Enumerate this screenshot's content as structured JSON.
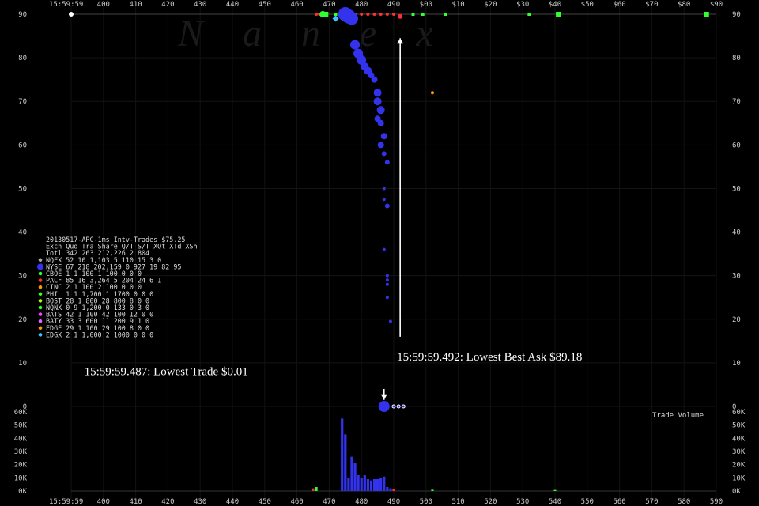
{
  "watermark": "Nanex",
  "chart_data": {
    "type": "scatter",
    "x_ticks": [
      "15:59:59",
      "400",
      "410",
      "420",
      "430",
      "440",
      "450",
      "460",
      "470",
      "480",
      "490",
      "500",
      "510",
      "520",
      "530",
      "540",
      "550",
      "560",
      "570",
      "580",
      "590"
    ],
    "x_top_ticks": [
      "15:59:59",
      "400",
      "410",
      "420",
      "430",
      "440",
      "450",
      "460",
      "470",
      "480",
      "490",
      "$00",
      "$10",
      "$20",
      "$30",
      "$40",
      "$50",
      "$60",
      "$70",
      "$80",
      "$90"
    ],
    "y_ticks": [
      "0",
      "10",
      "20",
      "30",
      "40",
      "50",
      "60",
      "70",
      "80",
      "90"
    ],
    "y_range": [
      0,
      90
    ],
    "volume_ticks": [
      "0K",
      "10K",
      "20K",
      "30K",
      "40K",
      "50K",
      "60K"
    ],
    "volume_range": [
      0,
      60000
    ],
    "volume_label": "Trade Volume",
    "x_range": [
      390,
      590
    ],
    "trades_nyse": [
      {
        "x": 475,
        "y": 90,
        "s": 9
      },
      {
        "x": 476,
        "y": 89.5,
        "s": 9
      },
      {
        "x": 477,
        "y": 89,
        "s": 8
      },
      {
        "x": 478,
        "y": 83,
        "s": 6
      },
      {
        "x": 479,
        "y": 81,
        "s": 6
      },
      {
        "x": 480,
        "y": 79.5,
        "s": 6
      },
      {
        "x": 481,
        "y": 78,
        "s": 5
      },
      {
        "x": 482,
        "y": 77,
        "s": 5
      },
      {
        "x": 483,
        "y": 76,
        "s": 4
      },
      {
        "x": 484,
        "y": 75,
        "s": 4
      },
      {
        "x": 485,
        "y": 72,
        "s": 5
      },
      {
        "x": 485,
        "y": 70,
        "s": 5
      },
      {
        "x": 486,
        "y": 68,
        "s": 5
      },
      {
        "x": 485,
        "y": 66,
        "s": 4
      },
      {
        "x": 486,
        "y": 65,
        "s": 4
      },
      {
        "x": 487,
        "y": 62,
        "s": 4
      },
      {
        "x": 486,
        "y": 60,
        "s": 4
      },
      {
        "x": 487,
        "y": 58,
        "s": 3
      },
      {
        "x": 488,
        "y": 56,
        "s": 3
      },
      {
        "x": 487,
        "y": 50,
        "s": 2
      },
      {
        "x": 487,
        "y": 47.5,
        "s": 2
      },
      {
        "x": 488,
        "y": 46,
        "s": 3
      },
      {
        "x": 487,
        "y": 36,
        "s": 2
      },
      {
        "x": 488,
        "y": 30,
        "s": 2
      },
      {
        "x": 488,
        "y": 29,
        "s": 2
      },
      {
        "x": 488,
        "y": 28,
        "s": 2
      },
      {
        "x": 488,
        "y": 25,
        "s": 2
      },
      {
        "x": 489,
        "y": 19.5,
        "s": 2
      },
      {
        "x": 487,
        "y": 0,
        "s": 7
      }
    ],
    "trades_edge": [
      {
        "x": 502,
        "y": 72,
        "s": 2
      }
    ],
    "trades_low_tail": [
      {
        "x": 490,
        "y": 0,
        "s": 2
      },
      {
        "x": 491.5,
        "y": 0,
        "s": 2
      },
      {
        "x": 493,
        "y": 0,
        "s": 2
      }
    ],
    "quotes_top": [
      {
        "x": 390,
        "y": 90,
        "c": "#ffffff",
        "s": 3
      },
      {
        "x": 466,
        "y": 90,
        "c": "#ff3030",
        "s": 2
      },
      {
        "x": 467,
        "y": 90,
        "c": "#ff3030",
        "s": 2
      },
      {
        "x": 468,
        "y": 90,
        "c": "#30ff30",
        "s": 4
      },
      {
        "x": 469,
        "y": 90,
        "c": "#30ff30",
        "s": 3
      },
      {
        "x": 472,
        "y": 89,
        "c": "#40c0ff",
        "s": 4
      },
      {
        "x": 472,
        "y": 90,
        "c": "#30ff30",
        "s": 2
      },
      {
        "x": 478,
        "y": 90,
        "c": "#ff3030",
        "s": 2
      },
      {
        "x": 480,
        "y": 90,
        "c": "#ff3030",
        "s": 2
      },
      {
        "x": 482,
        "y": 90,
        "c": "#ff3030",
        "s": 2
      },
      {
        "x": 484,
        "y": 90,
        "c": "#ff3030",
        "s": 2
      },
      {
        "x": 486,
        "y": 90,
        "c": "#ff3030",
        "s": 2
      },
      {
        "x": 488,
        "y": 90,
        "c": "#ff3030",
        "s": 2
      },
      {
        "x": 490,
        "y": 90,
        "c": "#ff3030",
        "s": 2
      },
      {
        "x": 492,
        "y": 89.5,
        "c": "#ff3030",
        "s": 3
      },
      {
        "x": 496,
        "y": 90,
        "c": "#30ff30",
        "s": 2
      },
      {
        "x": 499,
        "y": 90,
        "c": "#30ff30",
        "s": 2
      },
      {
        "x": 506,
        "y": 90,
        "c": "#30ff30",
        "s": 2
      },
      {
        "x": 532,
        "y": 90,
        "c": "#30ff30",
        "s": 2
      },
      {
        "x": 541,
        "y": 90,
        "c": "#30ff30",
        "s": 3
      },
      {
        "x": 587,
        "y": 90,
        "c": "#30ff30",
        "s": 3
      }
    ],
    "volume_bars": [
      {
        "x": 465,
        "v": 2000,
        "c": "#ff3030"
      },
      {
        "x": 466,
        "v": 3000,
        "c": "#30ff30"
      },
      {
        "x": 474,
        "v": 55000,
        "c": "#3333ee"
      },
      {
        "x": 475,
        "v": 43000,
        "c": "#3333ee"
      },
      {
        "x": 476,
        "v": 10000,
        "c": "#3333ee"
      },
      {
        "x": 477,
        "v": 26000,
        "c": "#3333ee"
      },
      {
        "x": 478,
        "v": 21000,
        "c": "#3333ee"
      },
      {
        "x": 479,
        "v": 12000,
        "c": "#3333ee"
      },
      {
        "x": 480,
        "v": 10000,
        "c": "#3333ee"
      },
      {
        "x": 481,
        "v": 12000,
        "c": "#3333ee"
      },
      {
        "x": 482,
        "v": 9000,
        "c": "#3333ee"
      },
      {
        "x": 483,
        "v": 8000,
        "c": "#3333ee"
      },
      {
        "x": 484,
        "v": 9000,
        "c": "#3333ee"
      },
      {
        "x": 485,
        "v": 9000,
        "c": "#3333ee"
      },
      {
        "x": 486,
        "v": 10000,
        "c": "#3333ee"
      },
      {
        "x": 487,
        "v": 11000,
        "c": "#3333ee"
      },
      {
        "x": 488,
        "v": 3000,
        "c": "#3333ee"
      },
      {
        "x": 489,
        "v": 2000,
        "c": "#3333ee"
      },
      {
        "x": 490,
        "v": 1500,
        "c": "#ff3030"
      },
      {
        "x": 502,
        "v": 1000,
        "c": "#30ff30"
      },
      {
        "x": 540,
        "v": 800,
        "c": "#30ff30"
      }
    ],
    "annotations": [
      {
        "text": "15:59:59.487: Lowest Trade $0.01",
        "x": 448,
        "y": 7.2,
        "arrow_x": 487,
        "arrow_from": 4,
        "arrow_to": 1.5
      },
      {
        "text": "15:59:59.492: Lowest Best Ask $89.18",
        "x": 492,
        "y": 10.5,
        "arrow_x": 492,
        "arrow_from": 16,
        "arrow_to": 84.5
      }
    ],
    "legend": {
      "title": "20130517-APC-1ms Intv-Trades $75.25",
      "header": "Exch Quo  Tra   Share  Q/T  S/T  XQt XTd XSh",
      "rows": [
        {
          "dot": "",
          "text": "Totl 342 263 212,226   2   804"
        },
        {
          "dot": "#aaaaaa",
          "text": "NQEX  52  10   1,103   5   110  15   3   0"
        },
        {
          "dot": "#3333ee",
          "text": "NYSE  67 218 202,159   0   927  19  82  95"
        },
        {
          "dot": "#30ff30",
          "text": "CBOE   1   1     100   1   100   0   0   0"
        },
        {
          "dot": "#ff3030",
          "text": "PACF  85  16   3,264   5   204  24   6   1"
        },
        {
          "dot": "#ff9900",
          "text": "CINC   2   1     100   2   100   0   0   0"
        },
        {
          "dot": "#30ff30",
          "text": "PHIL   1   1   1,700   1  1700   0   0   0"
        },
        {
          "dot": "#aaff00",
          "text": "BOST  28   1     800  28   800   8   0   0"
        },
        {
          "dot": "#30ff30",
          "text": "NQNX   0   9   1,200   0   133   0   3   0"
        },
        {
          "dot": "#ff44ff",
          "text": "BATS  42   1     100  42   100  12   0   0"
        },
        {
          "dot": "#dd66ff",
          "text": "BATY  33   3     600  11   200   9   1   0"
        },
        {
          "dot": "#ff9900",
          "text": "EDGE  29   1     100  29   100   8   0   0"
        },
        {
          "dot": "#40c0ff",
          "text": "EDGX   2   1   1,000   2  1000   0   0   0"
        }
      ]
    }
  }
}
